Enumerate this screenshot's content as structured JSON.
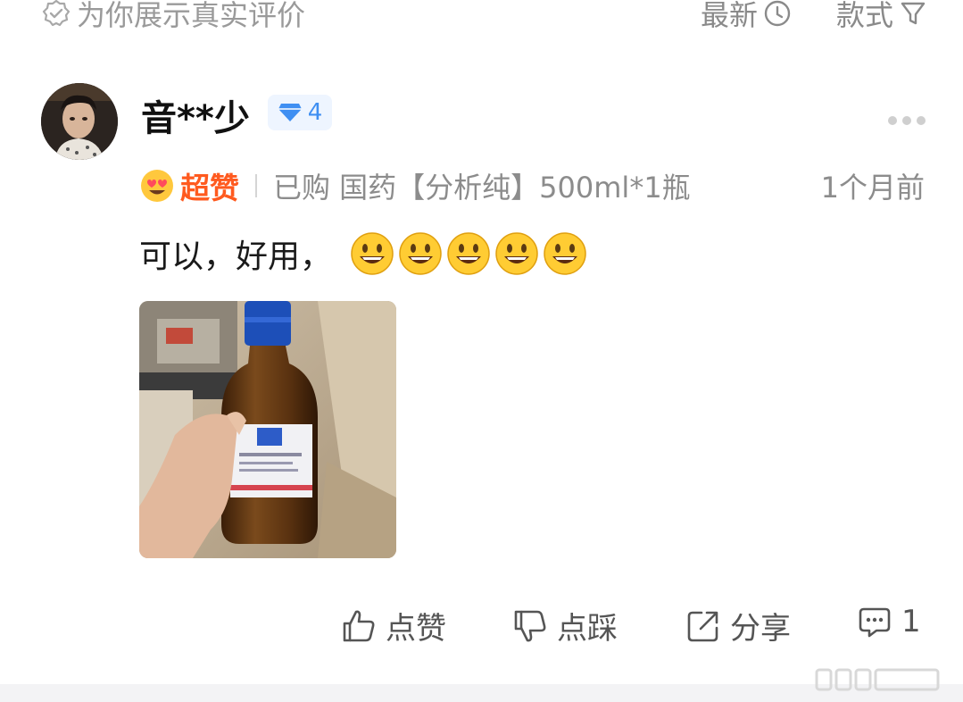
{
  "top_bar": {
    "title": "为你展示真实评价",
    "sort_label": "最新",
    "filter_label": "款式",
    "icons": {
      "title": "verified-badge-icon",
      "sort": "clock-icon",
      "filter": "funnel-icon"
    }
  },
  "review": {
    "username": "音**少",
    "level": "4",
    "rating_label": "超赞",
    "spec": "已购 国药【分析纯】500ml*1瓶",
    "time": "1个月前",
    "text": "可以，好用，",
    "emoji_count": 5
  },
  "actions": {
    "like": "点赞",
    "dislike": "点踩",
    "share": "分享",
    "comment_count": "1"
  },
  "colors": {
    "accent_orange": "#ff5a1f",
    "badge_blue": "#3f8ff2",
    "muted_text": "#8c8c8c"
  }
}
